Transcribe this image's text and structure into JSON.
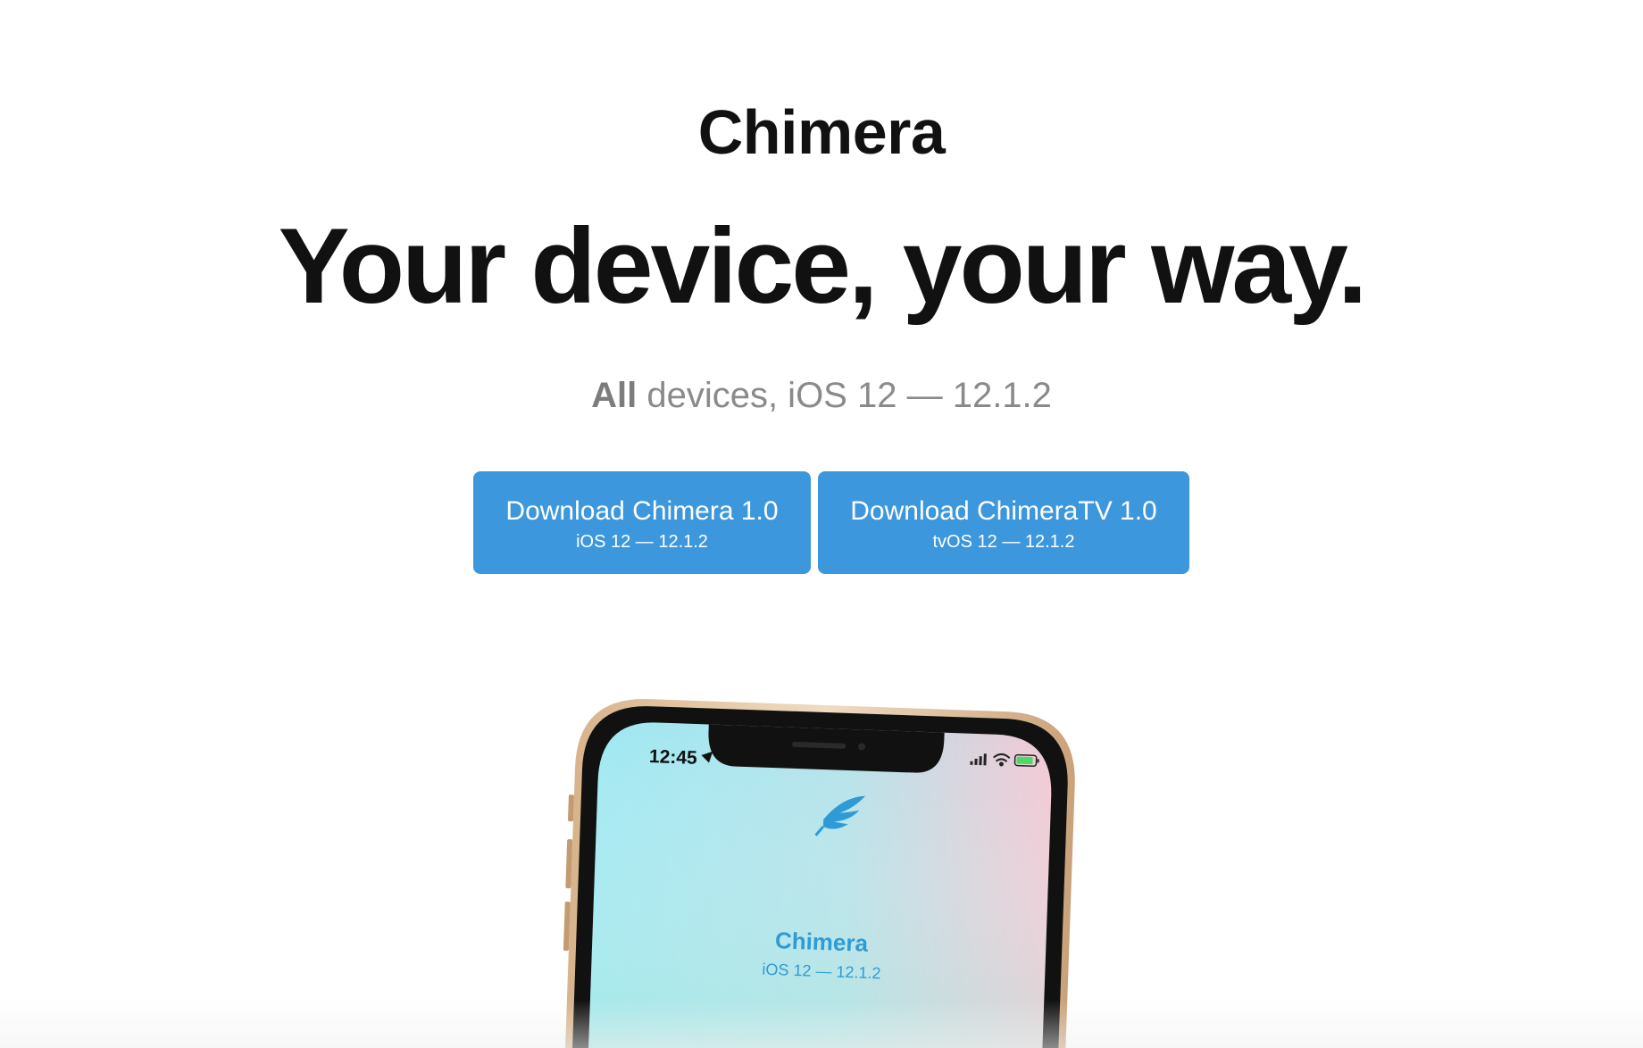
{
  "brand": "Chimera",
  "headline": "Your device, your way.",
  "subtitle": {
    "strong": "All",
    "rest": " devices, iOS 12 — 12.1.2"
  },
  "buttons": [
    {
      "title": "Download Chimera 1.0",
      "subtitle": "iOS 12 — 12.1.2"
    },
    {
      "title": "Download ChimeraTV 1.0",
      "subtitle": "tvOS 12 — 12.1.2"
    }
  ],
  "phone": {
    "time": "12:45",
    "app_name": "Chimera",
    "app_version": "iOS 12 — 12.1.2"
  },
  "colors": {
    "button": "#3d97dc",
    "text": "#111111",
    "muted": "#8a8a8a",
    "app_accent": "#2e9bd6"
  }
}
